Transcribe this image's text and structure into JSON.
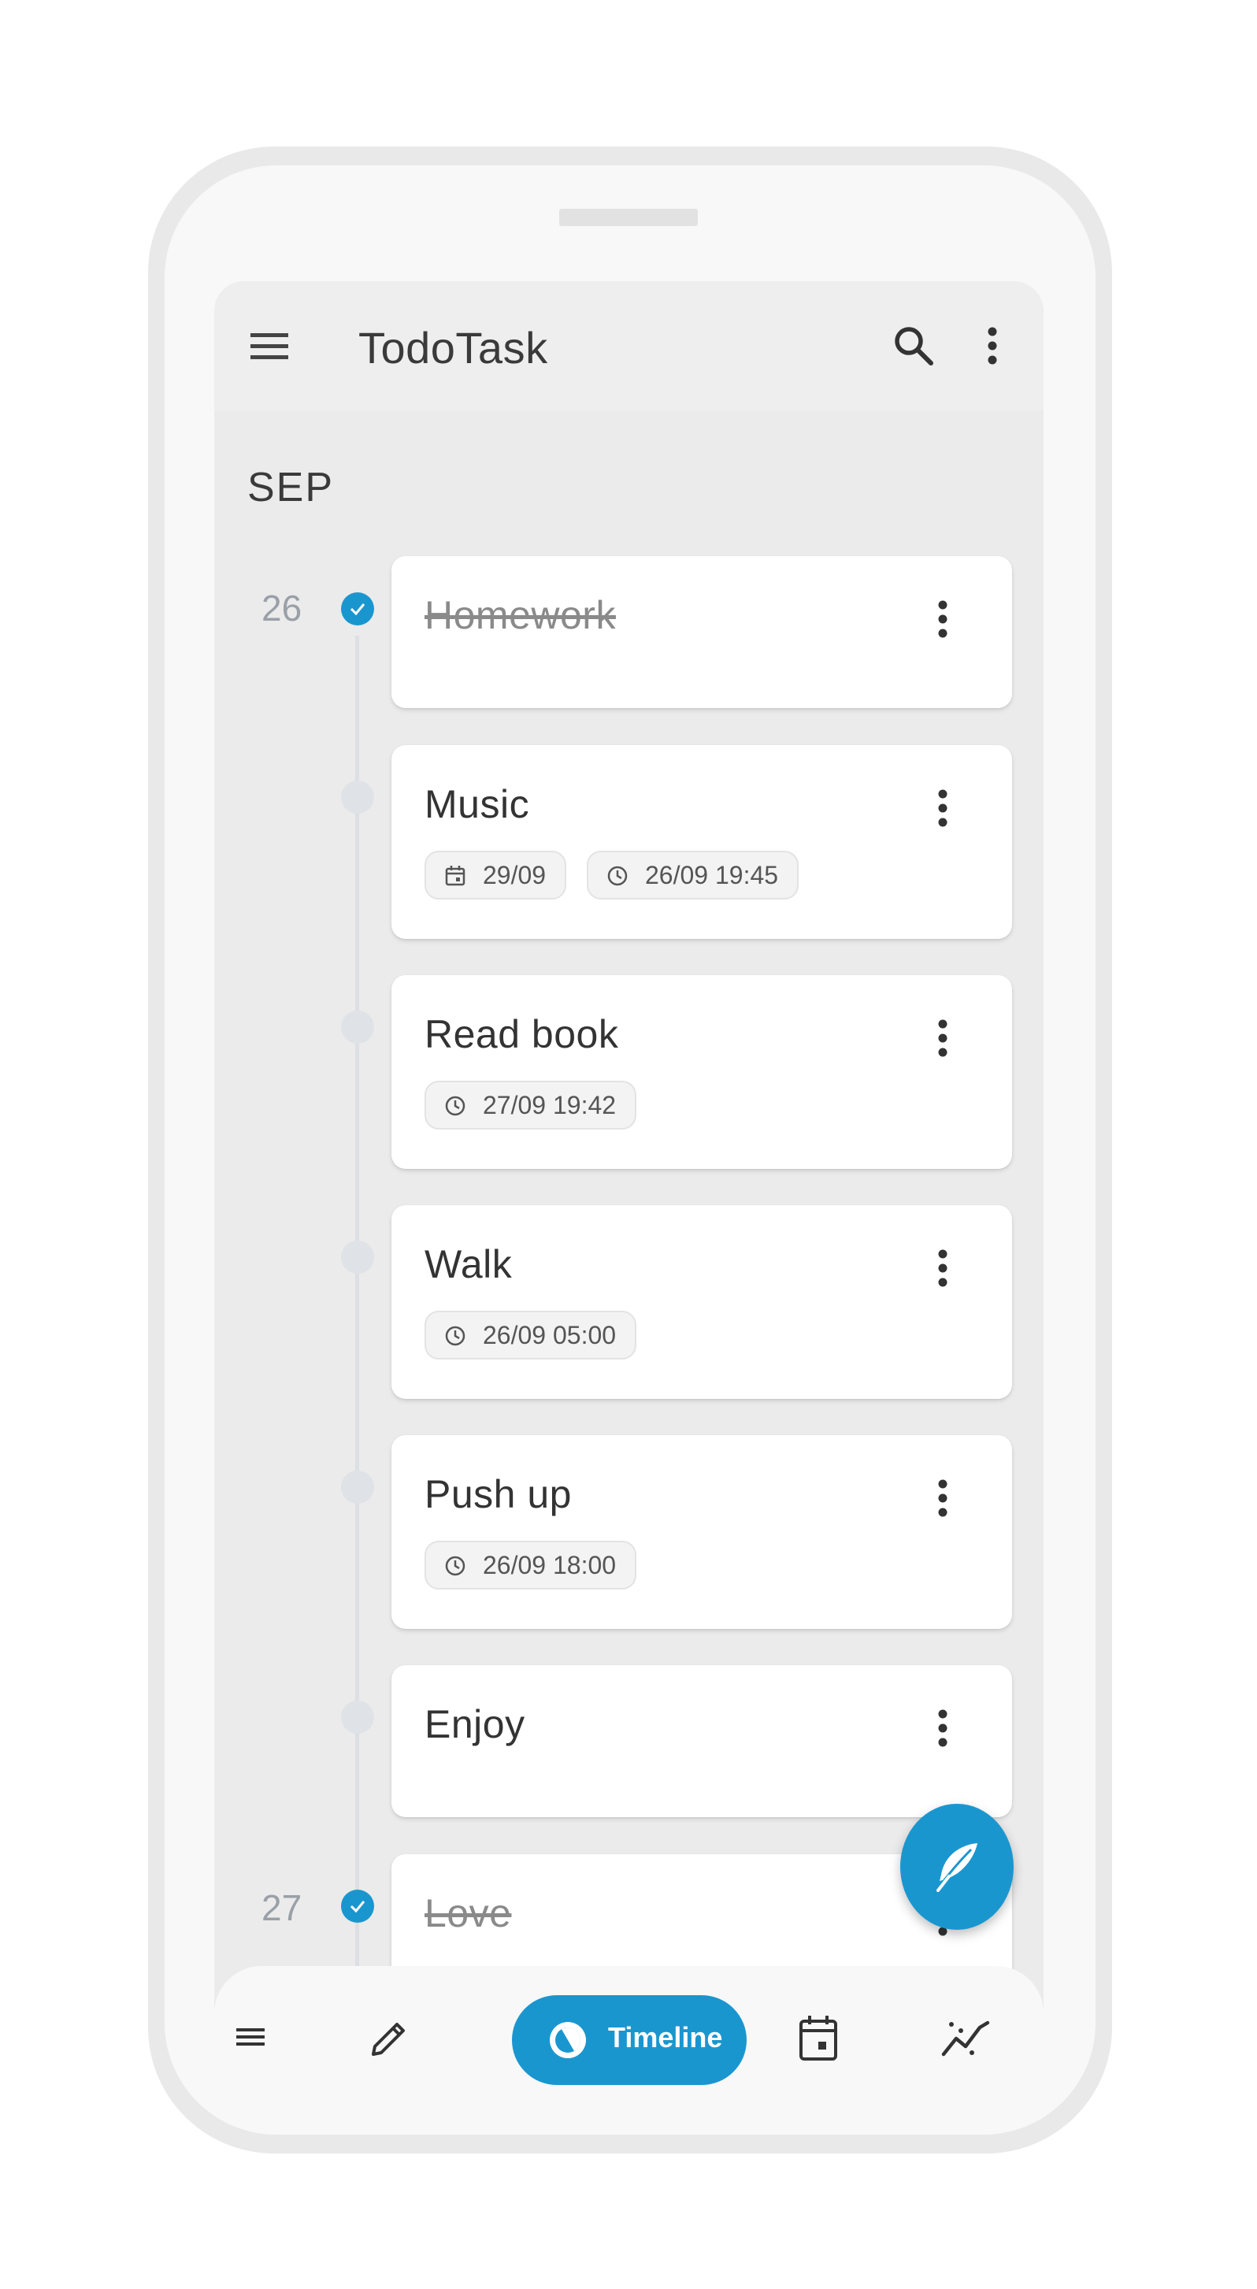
{
  "app": {
    "title": "TodoTask"
  },
  "colors": {
    "accent": "#1a96cf",
    "card": "#ffffff",
    "screen_bg": "#ebebeb"
  },
  "timeline": {
    "month": "SEP",
    "days": [
      {
        "day": "26"
      },
      {
        "day": "27"
      }
    ],
    "tasks": [
      {
        "title": "Homework",
        "done": true,
        "chips": []
      },
      {
        "title": "Music",
        "done": false,
        "chips": [
          {
            "icon": "calendar-icon",
            "text": "29/09"
          },
          {
            "icon": "clock-icon",
            "text": "26/09 19:45"
          }
        ]
      },
      {
        "title": "Read book",
        "done": false,
        "chips": [
          {
            "icon": "clock-icon",
            "text": "27/09 19:42"
          }
        ]
      },
      {
        "title": "Walk",
        "done": false,
        "chips": [
          {
            "icon": "clock-icon",
            "text": "26/09 05:00"
          }
        ]
      },
      {
        "title": "Push up",
        "done": false,
        "chips": [
          {
            "icon": "clock-icon",
            "text": "26/09 18:00"
          }
        ]
      },
      {
        "title": "Enjoy",
        "done": false,
        "chips": []
      },
      {
        "title": "Love",
        "done": true,
        "chips": []
      }
    ]
  },
  "fab": {
    "icon": "feather-icon"
  },
  "bottom_nav": {
    "items": [
      {
        "icon": "menu-icon"
      },
      {
        "icon": "pencil-icon"
      },
      {
        "icon": "timeline-icon",
        "label": "Timeline",
        "active": true
      },
      {
        "icon": "calendar-icon"
      },
      {
        "icon": "chart-icon"
      }
    ]
  }
}
